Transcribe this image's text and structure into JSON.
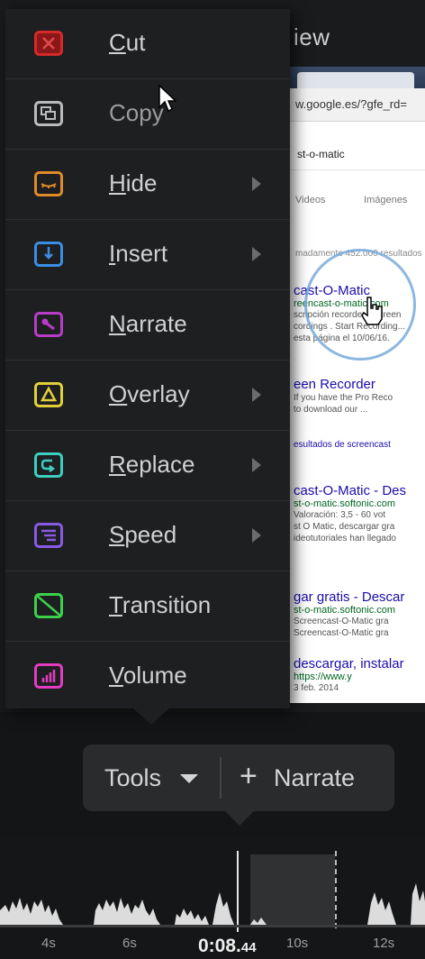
{
  "preview": {
    "title_fragment": "iew",
    "browser": {
      "address": "w.google.es/?gfe_rd=",
      "search_query": "st-o-matic",
      "tabs": [
        "Videos",
        "Imágenes"
      ],
      "result_count": "madamente 452.000 resultados",
      "results": [
        {
          "title": "cast-O-Matic",
          "url": "reencast-o-matic.com",
          "snippet": [
            "scripción recorder . Screen",
            "cordings . Start Recording...",
            "esta página el 10/06/16."
          ]
        },
        {
          "title": "een Recorder",
          "url": "",
          "snippet": [
            "If you have the Pro Reco",
            "to download our ..."
          ]
        },
        {
          "title": "cast-O-Matic - Des",
          "url": "st-o-matic.softonic.com",
          "snippet": [
            "Valoración: 3,5 - 60 vot",
            "st O Matic, descargar gra",
            "ideotutoriales han llegado"
          ]
        },
        {
          "title": "gar gratis - Descar",
          "url": "st-o-matic.softonic.com",
          "snippet": [
            "Screencast-O-Matic gra",
            "Screencast-O-Matic gra"
          ]
        },
        {
          "title": "descargar, instalar",
          "url": "https://www.y",
          "snippet": [
            "3 feb. 2014"
          ]
        }
      ],
      "more_results": "esultados de screencast"
    }
  },
  "menu": {
    "items": [
      {
        "key": "cut",
        "label": "Cut",
        "accel": "C",
        "rest": "ut",
        "color": "#d42a2a",
        "submenu": false
      },
      {
        "key": "copy",
        "label": "Copy",
        "accel": "",
        "rest": "Copy",
        "color": "#b9bbbd",
        "submenu": false
      },
      {
        "key": "hide",
        "label": "Hide",
        "accel": "H",
        "rest": "ide",
        "color": "#e08a2a",
        "submenu": true
      },
      {
        "key": "insert",
        "label": "Insert",
        "accel": "I",
        "rest": "nsert",
        "color": "#3a8ee6",
        "submenu": true
      },
      {
        "key": "narrate",
        "label": "Narrate",
        "accel": "N",
        "rest": "arrate",
        "color": "#b93cc9",
        "submenu": false
      },
      {
        "key": "overlay",
        "label": "Overlay",
        "accel": "O",
        "rest": "verlay",
        "color": "#e2d03a",
        "submenu": true
      },
      {
        "key": "replace",
        "label": "Replace",
        "accel": "R",
        "rest": "eplace",
        "color": "#3ccfc1",
        "submenu": true
      },
      {
        "key": "speed",
        "label": "Speed",
        "accel": "S",
        "rest": "peed",
        "color": "#8a5ae6",
        "submenu": true
      },
      {
        "key": "transition",
        "label": "Transition",
        "accel": "T",
        "rest": "ransition",
        "color": "#3cd14a",
        "submenu": false
      },
      {
        "key": "volume",
        "label": "Volume",
        "accel": "V",
        "rest": "olume",
        "color": "#e23cc2",
        "submenu": false
      }
    ]
  },
  "toolbar": {
    "tools_label": "Tools",
    "narrate_plus": "+",
    "narrate_label": "Narrate"
  },
  "timeline": {
    "ticks": [
      "4s",
      "6s",
      "10s",
      "12s"
    ],
    "current_time": "0:08.",
    "current_time_ms": "44"
  }
}
